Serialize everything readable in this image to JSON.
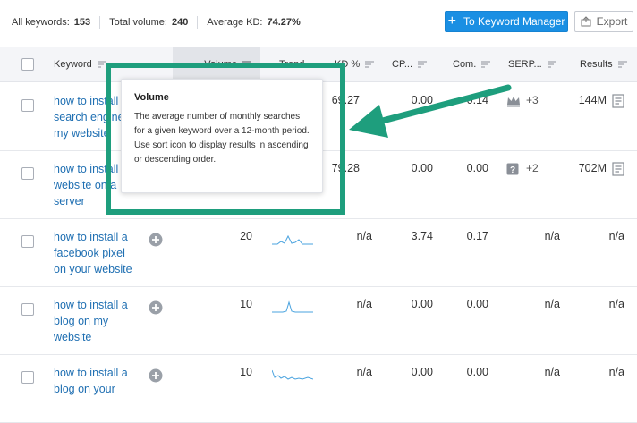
{
  "stats": {
    "all_keywords_label": "All keywords:",
    "all_keywords_value": "153",
    "total_volume_label": "Total volume:",
    "total_volume_value": "240",
    "avg_kd_label": "Average KD:",
    "avg_kd_value": "74.27%"
  },
  "toolbar": {
    "keyword_manager_label": "To Keyword Manager",
    "export_label": "Export"
  },
  "columns": {
    "keyword": "Keyword",
    "volume": "Volume",
    "trend": "Trend",
    "kd": "KD %",
    "cpc": "CP...",
    "com": "Com.",
    "serp": "SERP...",
    "results": "Results"
  },
  "rows": [
    {
      "keyword": "how to install a search engine on my website",
      "volume": "",
      "kd": "69.27",
      "cpc": "0.00",
      "com": "0.14",
      "serp_icon": "crown-icon",
      "serp": "+3",
      "results": "144M"
    },
    {
      "keyword": "how to install a website on a server",
      "volume": "",
      "kd": "79.28",
      "cpc": "0.00",
      "com": "0.00",
      "serp_icon": "question-icon",
      "serp": "+2",
      "results": "702M"
    },
    {
      "keyword": "how to install a facebook pixel on your website",
      "volume": "20",
      "kd": "n/a",
      "cpc": "3.74",
      "com": "0.17",
      "serp_icon": "",
      "serp": "n/a",
      "results": "n/a"
    },
    {
      "keyword": "how to install a blog on my website",
      "volume": "10",
      "kd": "n/a",
      "cpc": "0.00",
      "com": "0.00",
      "serp_icon": "",
      "serp": "n/a",
      "results": "n/a"
    },
    {
      "keyword": "how to install a blog on your",
      "volume": "10",
      "kd": "n/a",
      "cpc": "0.00",
      "com": "0.00",
      "serp_icon": "",
      "serp": "n/a",
      "results": "n/a"
    }
  ],
  "tooltip": {
    "title": "Volume",
    "body": "The average number of monthly searches for a given keyword over a 12-month period. Use sort icon to display results in ascending or descending order."
  },
  "colors": {
    "primary_button": "#1a8fe3",
    "link": "#1f6fb2",
    "annotation": "#1e9e7d",
    "trend_line": "#4aa3df"
  }
}
